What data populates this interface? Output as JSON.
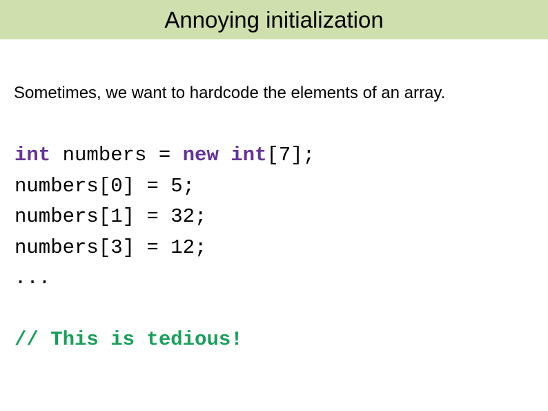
{
  "slide": {
    "title": "Annoying initialization",
    "banner_color": "#cfdfae",
    "background_color": "#ffffff",
    "title_color": "#000000"
  },
  "body": {
    "paragraph": "Sometimes, we want to hardcode the elements of an array."
  },
  "code": {
    "keyword_color": "#663399",
    "plain_color": "#000000",
    "comment_color": "#18a05a",
    "lines": [
      {
        "id": "line-1",
        "segments": [
          {
            "text": "int",
            "kind": "keyword"
          },
          {
            "text": " numbers = ",
            "kind": "plain"
          },
          {
            "text": "new int",
            "kind": "keyword"
          },
          {
            "text": "[7];",
            "kind": "plain"
          }
        ]
      },
      {
        "id": "line-2",
        "segments": [
          {
            "text": "numbers[0] = 5;",
            "kind": "plain"
          }
        ]
      },
      {
        "id": "line-3",
        "segments": [
          {
            "text": "numbers[1] = 32;",
            "kind": "plain"
          }
        ]
      },
      {
        "id": "line-4",
        "segments": [
          {
            "text": "numbers[3] = 12;",
            "kind": "plain"
          }
        ]
      },
      {
        "id": "line-5",
        "segments": [
          {
            "text": "...",
            "kind": "plain"
          }
        ]
      },
      {
        "id": "line-6",
        "segments": [
          {
            "text": " ",
            "kind": "blank"
          }
        ]
      },
      {
        "id": "line-7",
        "segments": [
          {
            "text": "// This is tedious!",
            "kind": "comment"
          }
        ]
      }
    ]
  }
}
